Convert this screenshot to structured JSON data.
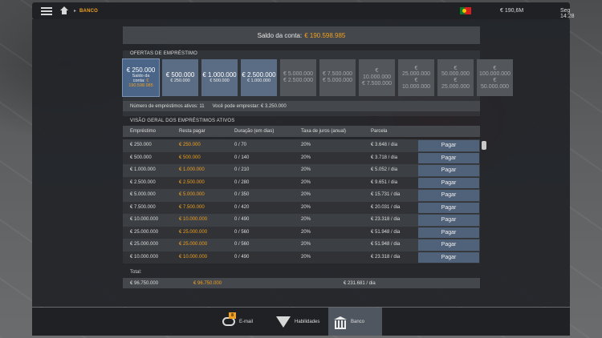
{
  "topbar": {
    "breadcrumb": "BANCO",
    "money": "€ 190,6M",
    "clock": "Seg 14:28"
  },
  "balance": {
    "label": "Saldo da conta:",
    "amount": "€ 190.598.985"
  },
  "offers": {
    "title": "OFERTAS DE EMPRÉSTIMO",
    "items": [
      {
        "line1": "€ 250.000",
        "line2": "Saldo da",
        "line3": "conta: ",
        "line3b": "€",
        "line4": "190.598.985",
        "state": "selected"
      },
      {
        "line1": "€ 500.000",
        "line2": "€ 250.000",
        "state": "enabled"
      },
      {
        "line1": "€ 1.000.000",
        "line2": "€ 500.000",
        "state": "enabled"
      },
      {
        "line1": "€ 2.500.000",
        "line2": "€ 1.000.000",
        "state": "enabled"
      },
      {
        "line1": "€ 5.000.000",
        "line2": "€ 2.500.000",
        "state": "disabled"
      },
      {
        "line1": "€ 7.500.000",
        "line2": "€ 5.000.000",
        "state": "disabled"
      },
      {
        "line1": "€",
        "line2": "10.000.000",
        "line3": "€ 7.500.000",
        "state": "disabled"
      },
      {
        "line1": "€",
        "line2": "25.000.000",
        "line3": "€",
        "line4": "10.000.000",
        "state": "disabled"
      },
      {
        "line1": "€",
        "line2": "50.000.000",
        "line3": "€",
        "line4": "25.000.000",
        "state": "disabled"
      },
      {
        "line1": "€",
        "line2": "100.000.000",
        "line3": "€",
        "line4": "50.000.000",
        "state": "disabled"
      }
    ]
  },
  "info": {
    "active_loans": "Número de empréstimos ativos: 11",
    "can_borrow": "Você pode emprestar: € 3.250.000"
  },
  "overview": {
    "title": "VISÃO GERAL DOS EMPRÉSTIMOS ATIVOS",
    "headers": {
      "loan": "Empréstimo",
      "remaining": "Resta pagar",
      "duration": "Duração (em dias)",
      "rate": "Taxa de juros (anual)",
      "installment": "Parcela"
    },
    "pay_label": "Pagar",
    "rows": [
      {
        "loan": "€ 250.000",
        "remaining": "€ 250.000",
        "duration": "0 / 70",
        "rate": "20%",
        "installment": "€ 3.648 / dia"
      },
      {
        "loan": "€ 500.000",
        "remaining": "€ 500.000",
        "duration": "0 / 140",
        "rate": "20%",
        "installment": "€ 3.718 / dia"
      },
      {
        "loan": "€ 1.000.000",
        "remaining": "€ 1.000.000",
        "duration": "0 / 210",
        "rate": "20%",
        "installment": "€ 5.052 / dia"
      },
      {
        "loan": "€ 2.500.000",
        "remaining": "€ 2.500.000",
        "duration": "0 / 280",
        "rate": "20%",
        "installment": "€ 9.651 / dia"
      },
      {
        "loan": "€ 5.000.000",
        "remaining": "€ 5.000.000",
        "duration": "0 / 350",
        "rate": "20%",
        "installment": "€ 15.731 / dia"
      },
      {
        "loan": "€ 7.500.000",
        "remaining": "€ 7.500.000",
        "duration": "0 / 420",
        "rate": "20%",
        "installment": "€ 20.031 / dia"
      },
      {
        "loan": "€ 10.000.000",
        "remaining": "€ 10.000.000",
        "duration": "0 / 490",
        "rate": "20%",
        "installment": "€ 23.318 / dia"
      },
      {
        "loan": "€ 25.000.000",
        "remaining": "€ 25.000.000",
        "duration": "0 / 560",
        "rate": "20%",
        "installment": "€ 51.948 / dia"
      },
      {
        "loan": "€ 25.000.000",
        "remaining": "€ 25.000.000",
        "duration": "0 / 560",
        "rate": "20%",
        "installment": "€ 51.948 / dia"
      },
      {
        "loan": "€ 10.000.000",
        "remaining": "€ 10.000.000",
        "duration": "0 / 490",
        "rate": "20%",
        "installment": "€ 23.318 / dia"
      }
    ],
    "total_label": "Total:",
    "total": {
      "loan": "€ 96.750.000",
      "remaining": "€ 96.750.000",
      "installment": "€ 231.681 / dia"
    }
  },
  "nav": {
    "email_label": "E-mail",
    "email_badge": "8",
    "skills_label": "Habilidades",
    "bank_label": "Banco"
  },
  "colors": {
    "accent": "#f0a020",
    "button": "#50627a",
    "panel": "#222428"
  }
}
